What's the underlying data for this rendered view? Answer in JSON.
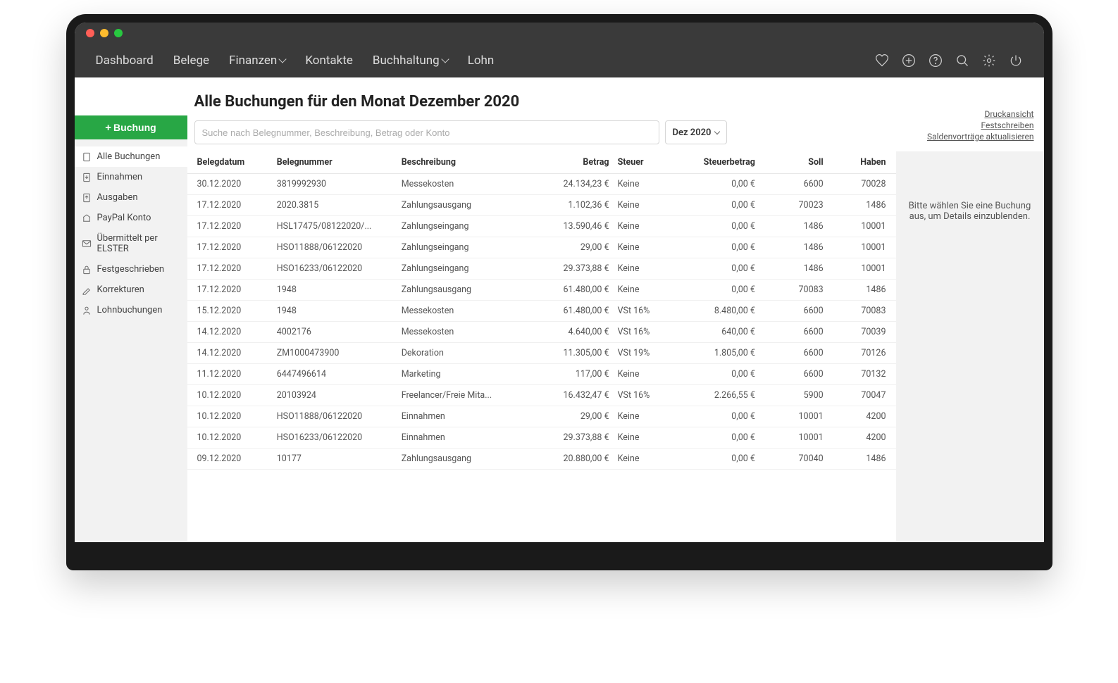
{
  "nav": {
    "items": [
      {
        "label": "Dashboard",
        "dropdown": false
      },
      {
        "label": "Belege",
        "dropdown": false
      },
      {
        "label": "Finanzen",
        "dropdown": true
      },
      {
        "label": "Kontakte",
        "dropdown": false
      },
      {
        "label": "Buchhaltung",
        "dropdown": true
      },
      {
        "label": "Lohn",
        "dropdown": false
      }
    ]
  },
  "add_button": "Buchung",
  "sidebar": {
    "items": [
      {
        "icon": "doc",
        "label": "Alle Buchungen",
        "active": true
      },
      {
        "icon": "in",
        "label": "Einnahmen"
      },
      {
        "icon": "out",
        "label": "Ausgaben"
      },
      {
        "icon": "bank",
        "label": "PayPal Konto"
      },
      {
        "icon": "mail",
        "label": "Übermittelt per ELSTER"
      },
      {
        "icon": "lock",
        "label": "Festgeschrieben"
      },
      {
        "icon": "edit",
        "label": "Korrekturen"
      },
      {
        "icon": "person",
        "label": "Lohnbuchungen"
      }
    ]
  },
  "page_title": "Alle Buchungen für den Monat Dezember 2020",
  "search_placeholder": "Suche nach Belegnummer, Beschreibung, Betrag oder Konto",
  "period": "Dez 2020",
  "links": {
    "print": "Druckansicht",
    "commit": "Festschreiben",
    "balances": "Saldenvorträge aktualisieren"
  },
  "columns": {
    "date": "Belegdatum",
    "num": "Belegnummer",
    "desc": "Beschreibung",
    "amount": "Betrag",
    "tax": "Steuer",
    "taxamt": "Steuerbetrag",
    "debit": "Soll",
    "credit": "Haben"
  },
  "rows": [
    {
      "date": "30.12.2020",
      "num": "3819992930",
      "desc": "Messekosten",
      "amount": "24.134,23 €",
      "tax": "Keine",
      "taxamt": "0,00 €",
      "debit": "6600",
      "credit": "70028"
    },
    {
      "date": "17.12.2020",
      "num": "2020.3815",
      "desc": "Zahlungsausgang",
      "amount": "1.102,36 €",
      "tax": "Keine",
      "taxamt": "0,00 €",
      "debit": "70023",
      "credit": "1486"
    },
    {
      "date": "17.12.2020",
      "num": "HSL17475/08122020/...",
      "desc": "Zahlungseingang",
      "amount": "13.590,46 €",
      "tax": "Keine",
      "taxamt": "0,00 €",
      "debit": "1486",
      "credit": "10001"
    },
    {
      "date": "17.12.2020",
      "num": "HSO11888/06122020",
      "desc": "Zahlungseingang",
      "amount": "29,00 €",
      "tax": "Keine",
      "taxamt": "0,00 €",
      "debit": "1486",
      "credit": "10001"
    },
    {
      "date": "17.12.2020",
      "num": "HSO16233/06122020",
      "desc": "Zahlungseingang",
      "amount": "29.373,88 €",
      "tax": "Keine",
      "taxamt": "0,00 €",
      "debit": "1486",
      "credit": "10001"
    },
    {
      "date": "17.12.2020",
      "num": "1948",
      "desc": "Zahlungsausgang",
      "amount": "61.480,00 €",
      "tax": "Keine",
      "taxamt": "0,00 €",
      "debit": "70083",
      "credit": "1486"
    },
    {
      "date": "15.12.2020",
      "num": "1948",
      "desc": "Messekosten",
      "amount": "61.480,00 €",
      "tax": "VSt 16%",
      "taxamt": "8.480,00 €",
      "debit": "6600",
      "credit": "70083"
    },
    {
      "date": "14.12.2020",
      "num": "4002176",
      "desc": "Messekosten",
      "amount": "4.640,00 €",
      "tax": "VSt 16%",
      "taxamt": "640,00 €",
      "debit": "6600",
      "credit": "70039"
    },
    {
      "date": "14.12.2020",
      "num": "ZM1000473900",
      "desc": "Dekoration",
      "amount": "11.305,00 €",
      "tax": "VSt 19%",
      "taxamt": "1.805,00 €",
      "debit": "6600",
      "credit": "70126"
    },
    {
      "date": "11.12.2020",
      "num": "6447496614",
      "desc": "Marketing",
      "amount": "117,00 €",
      "tax": "Keine",
      "taxamt": "0,00 €",
      "debit": "6600",
      "credit": "70132"
    },
    {
      "date": "10.12.2020",
      "num": "20103924",
      "desc": "Freelancer/Freie Mita...",
      "amount": "16.432,47 €",
      "tax": "VSt 16%",
      "taxamt": "2.266,55 €",
      "debit": "5900",
      "credit": "70047"
    },
    {
      "date": "10.12.2020",
      "num": "HSO11888/06122020",
      "desc": "Einnahmen",
      "amount": "29,00 €",
      "tax": "Keine",
      "taxamt": "0,00 €",
      "debit": "10001",
      "credit": "4200"
    },
    {
      "date": "10.12.2020",
      "num": "HSO16233/06122020",
      "desc": "Einnahmen",
      "amount": "29.373,88 €",
      "tax": "Keine",
      "taxamt": "0,00 €",
      "debit": "10001",
      "credit": "4200"
    },
    {
      "date": "09.12.2020",
      "num": "10177",
      "desc": "Zahlungsausgang",
      "amount": "20.880,00 €",
      "tax": "Keine",
      "taxamt": "0,00 €",
      "debit": "70040",
      "credit": "1486"
    }
  ],
  "detail_placeholder": "Bitte wählen Sie eine Buchung aus, um Details einzublenden."
}
